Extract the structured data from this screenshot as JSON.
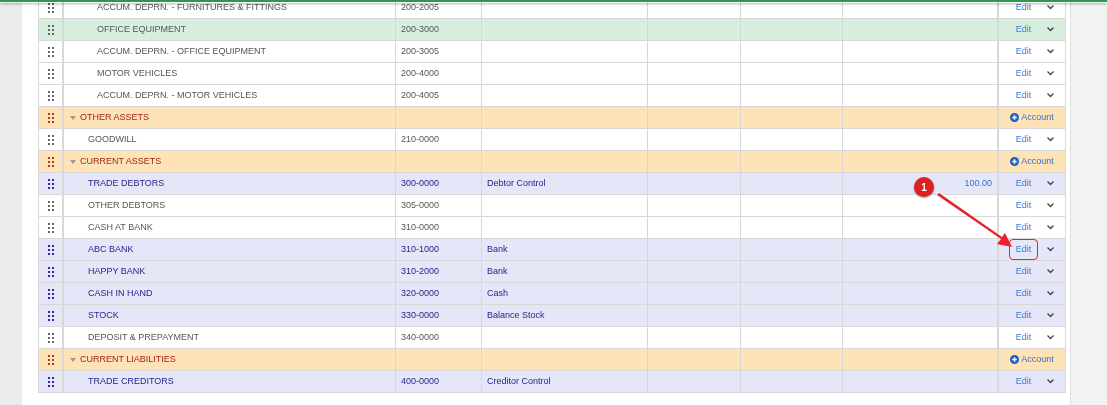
{
  "rows": [
    {
      "kind": "continued",
      "children": [
        {
          "kind": "account",
          "name": "ACCUM. DEPRN. - FURNITURES & FITTINGS",
          "code": "200-2005",
          "selected": false,
          "action": "Edit"
        },
        {
          "kind": "account",
          "name": "OFFICE EQUIPMENT",
          "code": "200-3000",
          "selected": true,
          "action": "Edit"
        },
        {
          "kind": "account",
          "name": "ACCUM. DEPRN. - OFFICE EQUIPMENT",
          "code": "200-3005",
          "selected": false,
          "action": "Edit"
        },
        {
          "kind": "account",
          "name": "MOTOR VEHICLES",
          "code": "200-4000",
          "selected": false,
          "action": "Edit"
        },
        {
          "kind": "account",
          "name": "ACCUM. DEPRN. - MOTOR VEHICLES",
          "code": "200-4005",
          "selected": false,
          "action": "Edit"
        }
      ]
    },
    {
      "kind": "category",
      "name": "OTHER ASSETS",
      "expanded": true,
      "action": "Account",
      "children": [
        {
          "kind": "account",
          "name": "GOODWILL",
          "code": "210-0000",
          "selected": false,
          "action": "Edit"
        }
      ]
    },
    {
      "kind": "category",
      "name": "CURRENT ASSETS",
      "expanded": true,
      "action": "Account",
      "children": [
        {
          "kind": "control",
          "name": "TRADE DEBTORS",
          "code": "300-0000",
          "type": "Debtor Control",
          "amount": "100.00",
          "selected": false,
          "action": "Edit"
        },
        {
          "kind": "account",
          "name": "OTHER DEBTORS",
          "code": "305-0000",
          "selected": false,
          "action": "Edit"
        },
        {
          "kind": "account",
          "name": "CASH AT BANK",
          "code": "310-0000",
          "selected": false,
          "action": "Edit"
        },
        {
          "kind": "control",
          "name": "ABC BANK",
          "code": "310-1000",
          "type": "Bank",
          "selected": false,
          "callout": true,
          "action": "Edit"
        },
        {
          "kind": "control",
          "name": "HAPPY BANK",
          "code": "310-2000",
          "type": "Bank",
          "selected": false,
          "action": "Edit"
        },
        {
          "kind": "control",
          "name": "CASH IN HAND",
          "code": "320-0000",
          "type": "Cash",
          "selected": false,
          "action": "Edit"
        },
        {
          "kind": "control",
          "name": "STOCK",
          "code": "330-0000",
          "type": "Balance Stock",
          "selected": false,
          "action": "Edit"
        },
        {
          "kind": "account",
          "name": "DEPOSIT & PREPAYMENT",
          "code": "340-0000",
          "selected": false,
          "action": "Edit"
        }
      ]
    },
    {
      "kind": "category",
      "name": "CURRENT LIABILITIES",
      "expanded": true,
      "action": "Account",
      "children": [
        {
          "kind": "control",
          "name": "TRADE CREDITORS",
          "code": "400-0000",
          "type": "Creditor Control",
          "selected": false,
          "action": "Edit"
        }
      ]
    }
  ],
  "annotation": {
    "badge": "1"
  }
}
